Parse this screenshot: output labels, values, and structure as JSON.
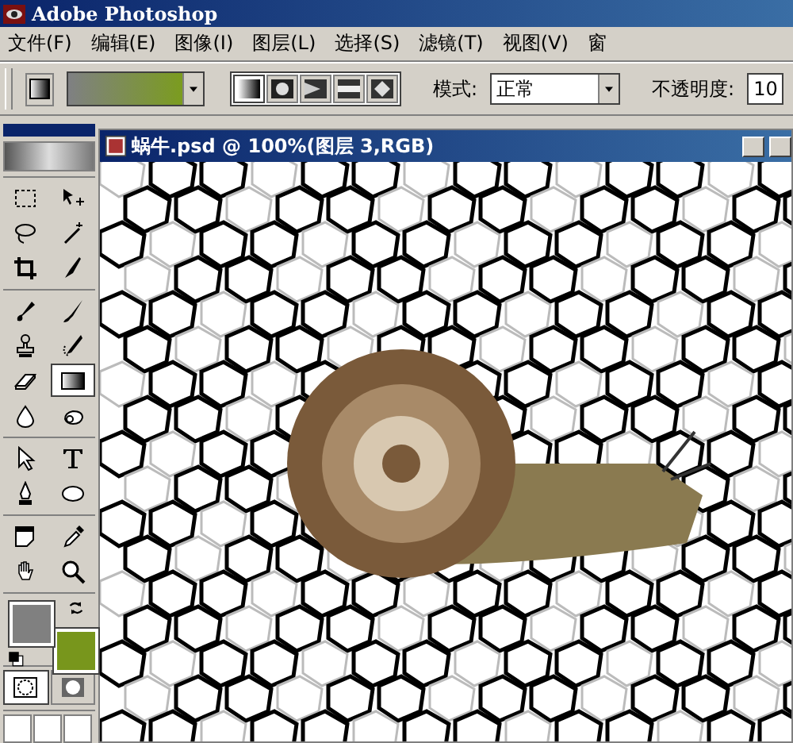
{
  "window": {
    "title": "Adobe Photoshop"
  },
  "menu": [
    "文件(F)",
    "编辑(E)",
    "图像(I)",
    "图层(L)",
    "选择(S)",
    "滤镜(T)",
    "视图(V)",
    "窗"
  ],
  "options_bar": {
    "gradient_types": [
      {
        "kind": "linear",
        "selected": true
      },
      {
        "kind": "radial",
        "selected": false
      },
      {
        "kind": "angle",
        "selected": false
      },
      {
        "kind": "reflected",
        "selected": false
      },
      {
        "kind": "diamond",
        "selected": false
      }
    ],
    "mode_label": "模式:",
    "mode_value": "正常",
    "opacity_label": "不透明度:",
    "opacity_value": "10"
  },
  "toolbox": {
    "groups": [
      [
        {
          "kind": "marquee",
          "selected": false
        },
        {
          "kind": "move",
          "selected": false
        },
        {
          "kind": "lasso",
          "selected": false
        },
        {
          "kind": "wand",
          "selected": false
        },
        {
          "kind": "crop",
          "selected": false
        },
        {
          "kind": "slice",
          "selected": false
        }
      ],
      [
        {
          "kind": "healing",
          "selected": false
        },
        {
          "kind": "brush",
          "selected": false
        },
        {
          "kind": "stamp",
          "selected": false
        },
        {
          "kind": "history",
          "selected": false
        },
        {
          "kind": "eraser",
          "selected": false
        },
        {
          "kind": "gradient",
          "selected": true
        },
        {
          "kind": "blur",
          "selected": false
        },
        {
          "kind": "dodge",
          "selected": false
        }
      ],
      [
        {
          "kind": "path",
          "selected": false
        },
        {
          "kind": "type",
          "selected": false
        },
        {
          "kind": "pen",
          "selected": false
        },
        {
          "kind": "shape",
          "selected": false
        }
      ],
      [
        {
          "kind": "notes",
          "selected": false
        },
        {
          "kind": "eyedropper",
          "selected": false
        },
        {
          "kind": "hand",
          "selected": false
        },
        {
          "kind": "zoom",
          "selected": false
        }
      ]
    ],
    "swatches": [
      {
        "kind": "foreground",
        "color": "#808080"
      },
      {
        "kind": "background",
        "color": "#78961c"
      }
    ],
    "mask_modes": [
      {
        "kind": "standard",
        "selected": true
      },
      {
        "kind": "quickmask",
        "selected": false
      }
    ]
  },
  "document": {
    "title": "蜗牛.psd @ 100%(图层 3,RGB)"
  }
}
